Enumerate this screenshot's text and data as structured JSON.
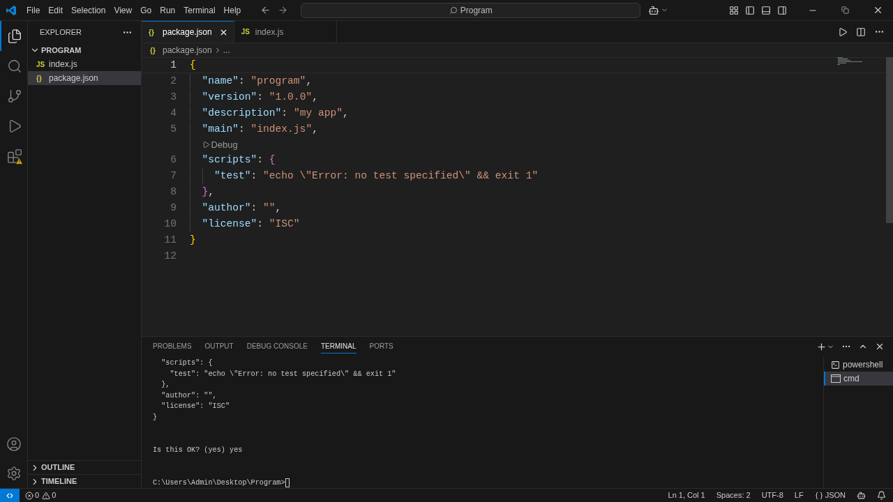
{
  "menu": [
    "File",
    "Edit",
    "Selection",
    "View",
    "Go",
    "Run",
    "Terminal",
    "Help"
  ],
  "search": {
    "value": "Program"
  },
  "activity": [
    {
      "kind": "files",
      "selected": true
    },
    {
      "kind": "search",
      "selected": false
    },
    {
      "kind": "git",
      "selected": false
    },
    {
      "kind": "debug",
      "selected": false
    },
    {
      "kind": "extensions",
      "selected": false,
      "warning": true
    }
  ],
  "sidebar": {
    "title": "EXPLORER",
    "folder": {
      "label": "PROGRAM",
      "expanded": true,
      "children": [
        {
          "label": "index.js",
          "icon": "JS",
          "selected": false
        },
        {
          "label": "package.json",
          "icon": "{}",
          "selected": true
        }
      ]
    },
    "sections": [
      {
        "label": "OUTLINE",
        "expanded": false
      },
      {
        "label": "TIMELINE",
        "expanded": false
      }
    ]
  },
  "tabs": [
    {
      "label": "package.json",
      "icon": "{}",
      "selected": true
    },
    {
      "label": "index.js",
      "icon": "JS",
      "selected": false
    }
  ],
  "breadcrumb": {
    "icon": "{}",
    "file": "package.json",
    "more": "..."
  },
  "editor": {
    "lines": [
      {
        "kind": "code",
        "number": "1",
        "active": true,
        "tokens": [
          {
            "kind": "bracket1",
            "text": "{"
          }
        ],
        "children": [
          {
            "kind": "code",
            "number": "2",
            "active": false,
            "tokens": [
              {
                "kind": "key",
                "text": "\"name\""
              },
              {
                "kind": "punct",
                "text": ": "
              },
              {
                "kind": "string",
                "text": "\"program\""
              },
              {
                "kind": "punct",
                "text": ","
              }
            ]
          },
          {
            "kind": "code",
            "number": "3",
            "active": false,
            "tokens": [
              {
                "kind": "key",
                "text": "\"version\""
              },
              {
                "kind": "punct",
                "text": ": "
              },
              {
                "kind": "string",
                "text": "\"1.0.0\""
              },
              {
                "kind": "punct",
                "text": ","
              }
            ]
          },
          {
            "kind": "code",
            "number": "4",
            "active": false,
            "tokens": [
              {
                "kind": "key",
                "text": "\"description\""
              },
              {
                "kind": "punct",
                "text": ": "
              },
              {
                "kind": "string",
                "text": "\"my app\""
              },
              {
                "kind": "punct",
                "text": ","
              }
            ]
          },
          {
            "kind": "code",
            "number": "5",
            "active": false,
            "tokens": [
              {
                "kind": "key",
                "text": "\"main\""
              },
              {
                "kind": "punct",
                "text": ": "
              },
              {
                "kind": "string",
                "text": "\"index.js\""
              },
              {
                "kind": "punct",
                "text": ","
              }
            ]
          },
          {
            "kind": "codelens",
            "text": "Debug"
          },
          {
            "kind": "code",
            "number": "6",
            "active": false,
            "tokens": [
              {
                "kind": "key",
                "text": "\"scripts\""
              },
              {
                "kind": "punct",
                "text": ": "
              },
              {
                "kind": "bracket2",
                "text": "{"
              }
            ],
            "children": [
              {
                "kind": "code",
                "number": "7",
                "active": false,
                "tokens": [
                  {
                    "kind": "key",
                    "text": "\"test\""
                  },
                  {
                    "kind": "punct",
                    "text": ": "
                  },
                  {
                    "kind": "string",
                    "text": "\"echo \\\"Error: no test specified\\\" && exit 1\""
                  }
                ]
              }
            ]
          },
          {
            "kind": "code",
            "number": "8",
            "active": false,
            "tokens": [
              {
                "kind": "bracket2",
                "text": "}"
              },
              {
                "kind": "punct",
                "text": ","
              }
            ]
          },
          {
            "kind": "code",
            "number": "9",
            "active": false,
            "tokens": [
              {
                "kind": "key",
                "text": "\"author\""
              },
              {
                "kind": "punct",
                "text": ": "
              },
              {
                "kind": "string",
                "text": "\"\""
              },
              {
                "kind": "punct",
                "text": ","
              }
            ]
          },
          {
            "kind": "code",
            "number": "10",
            "active": false,
            "tokens": [
              {
                "kind": "key",
                "text": "\"license\""
              },
              {
                "kind": "punct",
                "text": ": "
              },
              {
                "kind": "string",
                "text": "\"ISC\""
              }
            ]
          }
        ]
      },
      {
        "kind": "code",
        "number": "11",
        "active": false,
        "tokens": [
          {
            "kind": "bracket1",
            "text": "}"
          }
        ]
      },
      {
        "kind": "code",
        "number": "12",
        "active": false
      }
    ]
  },
  "panel": {
    "tabs": [
      {
        "label": "PROBLEMS",
        "selected": false
      },
      {
        "label": "OUTPUT",
        "selected": false
      },
      {
        "label": "DEBUG CONSOLE",
        "selected": false
      },
      {
        "label": "TERMINAL",
        "selected": true
      },
      {
        "label": "PORTS",
        "selected": false
      }
    ],
    "terminal_blocks": [
      [
        "  \"scripts\": {",
        "    \"test\": \"echo \\\"Error: no test specified\\\" && exit 1\"",
        "  },",
        "  \"author\": \"\",",
        "  \"license\": \"ISC\"",
        "}"
      ],
      [
        "Is this OK? (yes) yes"
      ]
    ],
    "prompt": "C:\\Users\\Admin\\Desktop\\Program>",
    "terminals": [
      {
        "label": "powershell",
        "kind": "powershell",
        "selected": false
      },
      {
        "label": "cmd",
        "kind": "cmd",
        "selected": true
      }
    ]
  },
  "status_bar": {
    "errors": "0",
    "warnings": "0",
    "items": [
      "Ln 1, Col 1",
      "Spaces: 2",
      "UTF-8",
      "LF"
    ],
    "language": "JSON"
  }
}
